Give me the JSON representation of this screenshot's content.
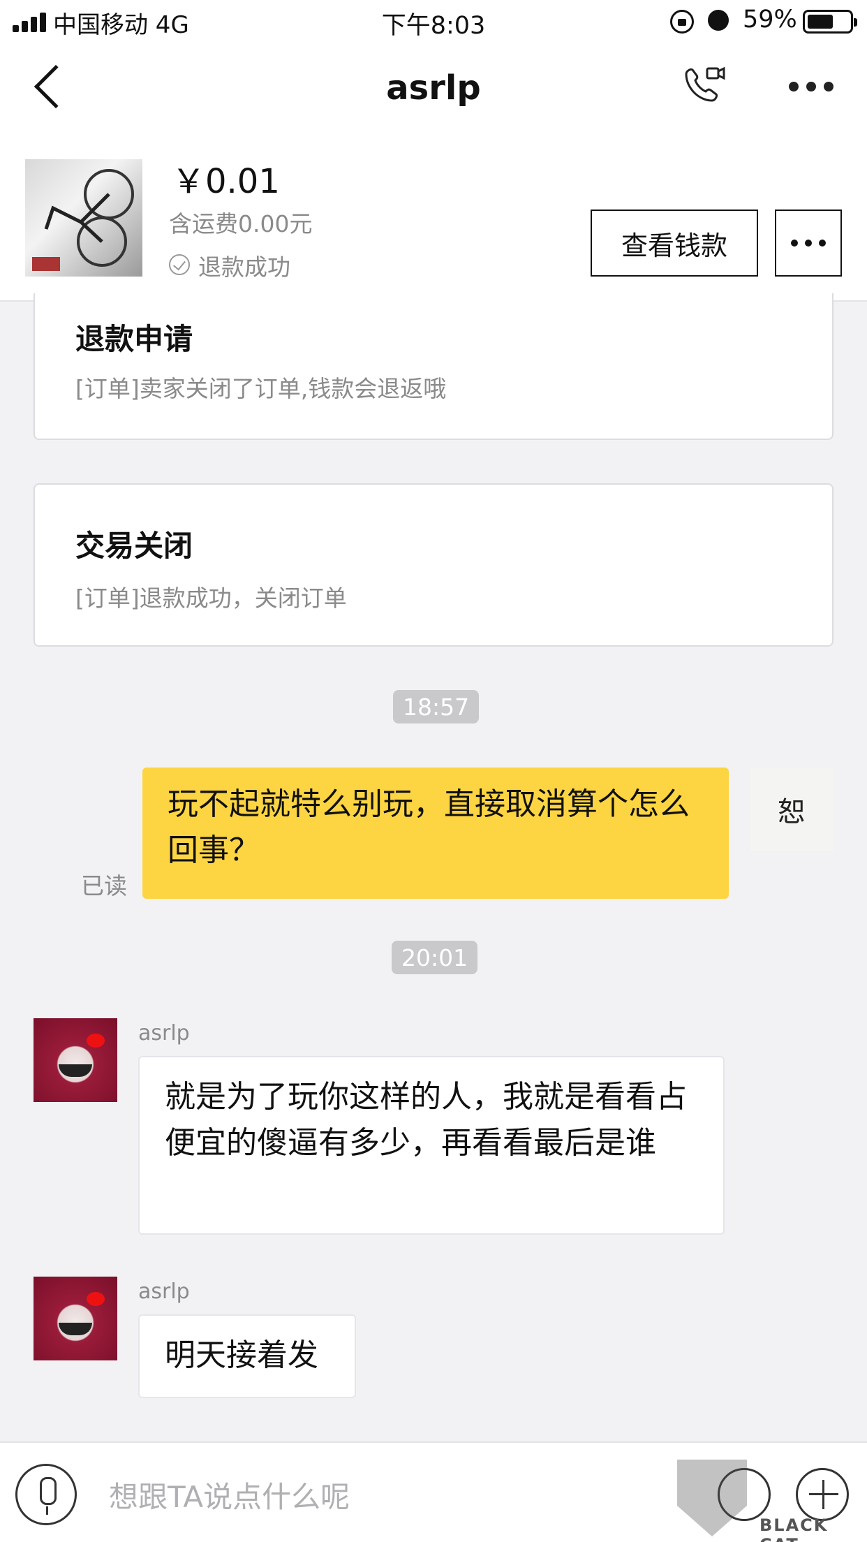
{
  "status_bar": {
    "carrier": "中国移动  4G",
    "time": "下午8:03",
    "battery_percent": "59%"
  },
  "nav": {
    "title": "asrlp",
    "icons": [
      "back-icon",
      "video-call-icon",
      "more-icon"
    ]
  },
  "product": {
    "price": "￥0.01",
    "shipping": "含运费0.00元",
    "status": "退款成功",
    "view_money_label": "查看钱款"
  },
  "notices": [
    {
      "title": "退款申请",
      "desc": "[订单]卖家关闭了订单,钱款会退返哦"
    },
    {
      "title": "交易关闭",
      "desc": "[订单]退款成功，关闭订单"
    }
  ],
  "messages": {
    "time1": "18:57",
    "self_text": "玩不起就特么别玩，直接取消算个怎么回事？",
    "read_label": "已读",
    "self_avatar_text": "恕",
    "time2": "20:01",
    "peer1_name": "asrlp",
    "peer1_text": "就是为了玩你这样的人，我就是看看占便宜的傻逼有多少，再看看最后是谁",
    "peer2_name": "asrlp",
    "peer2_text": "明天接着发"
  },
  "input": {
    "placeholder": "想跟TA说点什么呢"
  },
  "watermark": {
    "text": "BLACK CAT"
  },
  "colors": {
    "self_bubble": "#fdd542",
    "background": "#f2f2f5",
    "time_chip": "#c9c9cc"
  }
}
